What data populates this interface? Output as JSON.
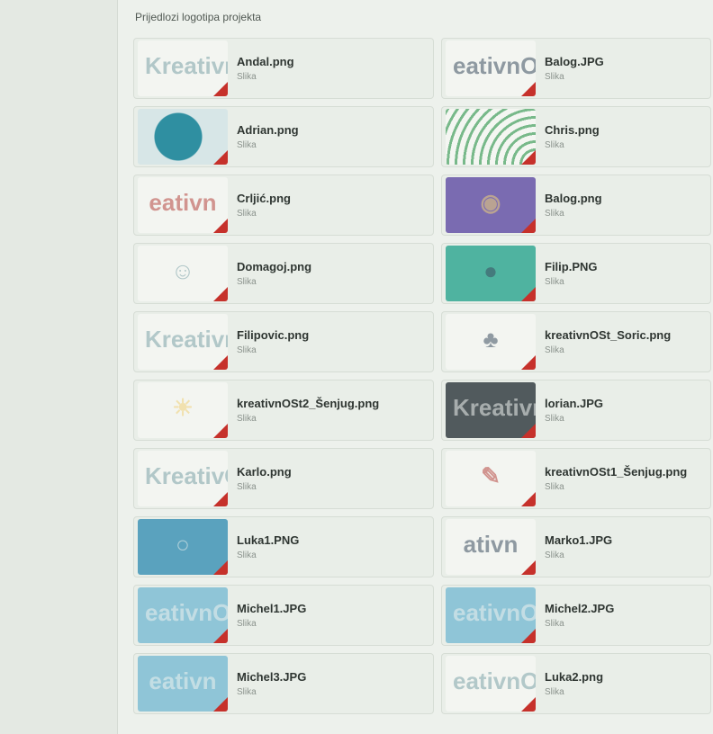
{
  "section": {
    "title": "Prijedlozi logotipa projekta"
  },
  "files": [
    {
      "name": "Andal.png",
      "type": "Slika",
      "thumb": "t-light",
      "art": "KreativnOSt",
      "art_class": "dim"
    },
    {
      "name": "Balog.JPG",
      "type": "Slika",
      "thumb": "t-light",
      "art": "eativnO",
      "art_class": "navy"
    },
    {
      "name": "Adrian.png",
      "type": "Slika",
      "thumb": "t-globe",
      "art": "",
      "art_class": ""
    },
    {
      "name": "Chris.png",
      "type": "Slika",
      "thumb": "t-arcs",
      "art": "",
      "art_class": ""
    },
    {
      "name": "Crljić.png",
      "type": "Slika",
      "thumb": "t-light",
      "art": "eativn",
      "art_class": "red"
    },
    {
      "name": "Balog.png",
      "type": "Slika",
      "thumb": "t-purple",
      "art": "◉",
      "art_class": "yellow"
    },
    {
      "name": "Domagoj.png",
      "type": "Slika",
      "thumb": "t-light",
      "art": "☺",
      "art_class": "dim"
    },
    {
      "name": "Filip.PNG",
      "type": "Slika",
      "thumb": "t-teal",
      "art": "●",
      "art_class": "navy"
    },
    {
      "name": "Filipovic.png",
      "type": "Slika",
      "thumb": "t-light",
      "art": "KreativnO",
      "art_class": "dim"
    },
    {
      "name": "kreativnOSt_Soric.png",
      "type": "Slika",
      "thumb": "t-light",
      "art": "♣",
      "art_class": "navy"
    },
    {
      "name": "kreativnOSt2_Šenjug.png",
      "type": "Slika",
      "thumb": "t-light",
      "art": "☀",
      "art_class": "yellow"
    },
    {
      "name": "lorian.JPG",
      "type": "Slika",
      "thumb": "t-dark",
      "art": "KreativnO",
      "art_class": "white"
    },
    {
      "name": "Karlo.png",
      "type": "Slika",
      "thumb": "t-light",
      "art": "KreativOS",
      "art_class": "dim"
    },
    {
      "name": "kreativnOSt1_Šenjug.png",
      "type": "Slika",
      "thumb": "t-light",
      "art": "✎",
      "art_class": "red"
    },
    {
      "name": "Luka1.PNG",
      "type": "Slika",
      "thumb": "t-blue",
      "art": "○",
      "art_class": "white"
    },
    {
      "name": "Marko1.JPG",
      "type": "Slika",
      "thumb": "t-light",
      "art": "ativn",
      "art_class": "navy"
    },
    {
      "name": "Michel1.JPG",
      "type": "Slika",
      "thumb": "t-sky",
      "art": "eativnO",
      "art_class": "white"
    },
    {
      "name": "Michel2.JPG",
      "type": "Slika",
      "thumb": "t-sky",
      "art": "eativnO",
      "art_class": "white"
    },
    {
      "name": "Michel3.JPG",
      "type": "Slika",
      "thumb": "t-sky",
      "art": "eativn",
      "art_class": "white"
    },
    {
      "name": "Luka2.png",
      "type": "Slika",
      "thumb": "t-light",
      "art": "eativnO",
      "art_class": "dim"
    }
  ]
}
